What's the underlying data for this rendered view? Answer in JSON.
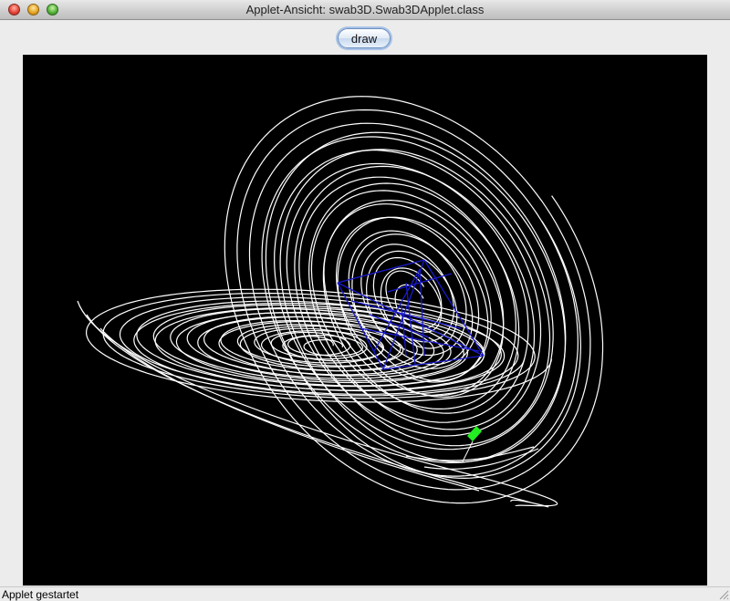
{
  "window": {
    "title": "Applet-Ansicht: swab3D.Swab3DApplet.class"
  },
  "toolbar": {
    "draw_label": "draw"
  },
  "status": {
    "text": "Applet gestartet"
  },
  "colors": {
    "canvas_background": "#000000",
    "trajectory": "#ffffff",
    "wireframe": "#1a1acc",
    "marker": "#22ee22"
  },
  "icons": {
    "close": "close-icon",
    "minimize": "minimize-icon",
    "zoom": "zoom-icon",
    "resize": "resize-grip-icon"
  }
}
